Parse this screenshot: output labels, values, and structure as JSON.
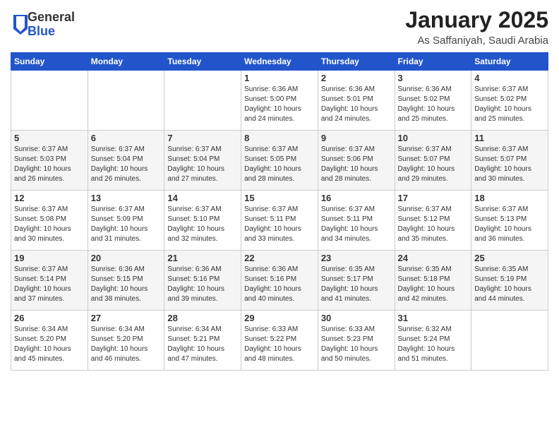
{
  "header": {
    "logo_general": "General",
    "logo_blue": "Blue",
    "month": "January 2025",
    "location": "As Saffaniyah, Saudi Arabia"
  },
  "weekdays": [
    "Sunday",
    "Monday",
    "Tuesday",
    "Wednesday",
    "Thursday",
    "Friday",
    "Saturday"
  ],
  "rows": [
    {
      "alt": false,
      "cells": [
        {
          "date": "",
          "info": ""
        },
        {
          "date": "",
          "info": ""
        },
        {
          "date": "",
          "info": ""
        },
        {
          "date": "1",
          "info": "Sunrise: 6:36 AM\nSunset: 5:00 PM\nDaylight: 10 hours\nand 24 minutes."
        },
        {
          "date": "2",
          "info": "Sunrise: 6:36 AM\nSunset: 5:01 PM\nDaylight: 10 hours\nand 24 minutes."
        },
        {
          "date": "3",
          "info": "Sunrise: 6:36 AM\nSunset: 5:02 PM\nDaylight: 10 hours\nand 25 minutes."
        },
        {
          "date": "4",
          "info": "Sunrise: 6:37 AM\nSunset: 5:02 PM\nDaylight: 10 hours\nand 25 minutes."
        }
      ]
    },
    {
      "alt": true,
      "cells": [
        {
          "date": "5",
          "info": "Sunrise: 6:37 AM\nSunset: 5:03 PM\nDaylight: 10 hours\nand 26 minutes."
        },
        {
          "date": "6",
          "info": "Sunrise: 6:37 AM\nSunset: 5:04 PM\nDaylight: 10 hours\nand 26 minutes."
        },
        {
          "date": "7",
          "info": "Sunrise: 6:37 AM\nSunset: 5:04 PM\nDaylight: 10 hours\nand 27 minutes."
        },
        {
          "date": "8",
          "info": "Sunrise: 6:37 AM\nSunset: 5:05 PM\nDaylight: 10 hours\nand 28 minutes."
        },
        {
          "date": "9",
          "info": "Sunrise: 6:37 AM\nSunset: 5:06 PM\nDaylight: 10 hours\nand 28 minutes."
        },
        {
          "date": "10",
          "info": "Sunrise: 6:37 AM\nSunset: 5:07 PM\nDaylight: 10 hours\nand 29 minutes."
        },
        {
          "date": "11",
          "info": "Sunrise: 6:37 AM\nSunset: 5:07 PM\nDaylight: 10 hours\nand 30 minutes."
        }
      ]
    },
    {
      "alt": false,
      "cells": [
        {
          "date": "12",
          "info": "Sunrise: 6:37 AM\nSunset: 5:08 PM\nDaylight: 10 hours\nand 30 minutes."
        },
        {
          "date": "13",
          "info": "Sunrise: 6:37 AM\nSunset: 5:09 PM\nDaylight: 10 hours\nand 31 minutes."
        },
        {
          "date": "14",
          "info": "Sunrise: 6:37 AM\nSunset: 5:10 PM\nDaylight: 10 hours\nand 32 minutes."
        },
        {
          "date": "15",
          "info": "Sunrise: 6:37 AM\nSunset: 5:11 PM\nDaylight: 10 hours\nand 33 minutes."
        },
        {
          "date": "16",
          "info": "Sunrise: 6:37 AM\nSunset: 5:11 PM\nDaylight: 10 hours\nand 34 minutes."
        },
        {
          "date": "17",
          "info": "Sunrise: 6:37 AM\nSunset: 5:12 PM\nDaylight: 10 hours\nand 35 minutes."
        },
        {
          "date": "18",
          "info": "Sunrise: 6:37 AM\nSunset: 5:13 PM\nDaylight: 10 hours\nand 36 minutes."
        }
      ]
    },
    {
      "alt": true,
      "cells": [
        {
          "date": "19",
          "info": "Sunrise: 6:37 AM\nSunset: 5:14 PM\nDaylight: 10 hours\nand 37 minutes."
        },
        {
          "date": "20",
          "info": "Sunrise: 6:36 AM\nSunset: 5:15 PM\nDaylight: 10 hours\nand 38 minutes."
        },
        {
          "date": "21",
          "info": "Sunrise: 6:36 AM\nSunset: 5:16 PM\nDaylight: 10 hours\nand 39 minutes."
        },
        {
          "date": "22",
          "info": "Sunrise: 6:36 AM\nSunset: 5:16 PM\nDaylight: 10 hours\nand 40 minutes."
        },
        {
          "date": "23",
          "info": "Sunrise: 6:35 AM\nSunset: 5:17 PM\nDaylight: 10 hours\nand 41 minutes."
        },
        {
          "date": "24",
          "info": "Sunrise: 6:35 AM\nSunset: 5:18 PM\nDaylight: 10 hours\nand 42 minutes."
        },
        {
          "date": "25",
          "info": "Sunrise: 6:35 AM\nSunset: 5:19 PM\nDaylight: 10 hours\nand 44 minutes."
        }
      ]
    },
    {
      "alt": false,
      "cells": [
        {
          "date": "26",
          "info": "Sunrise: 6:34 AM\nSunset: 5:20 PM\nDaylight: 10 hours\nand 45 minutes."
        },
        {
          "date": "27",
          "info": "Sunrise: 6:34 AM\nSunset: 5:20 PM\nDaylight: 10 hours\nand 46 minutes."
        },
        {
          "date": "28",
          "info": "Sunrise: 6:34 AM\nSunset: 5:21 PM\nDaylight: 10 hours\nand 47 minutes."
        },
        {
          "date": "29",
          "info": "Sunrise: 6:33 AM\nSunset: 5:22 PM\nDaylight: 10 hours\nand 48 minutes."
        },
        {
          "date": "30",
          "info": "Sunrise: 6:33 AM\nSunset: 5:23 PM\nDaylight: 10 hours\nand 50 minutes."
        },
        {
          "date": "31",
          "info": "Sunrise: 6:32 AM\nSunset: 5:24 PM\nDaylight: 10 hours\nand 51 minutes."
        },
        {
          "date": "",
          "info": ""
        }
      ]
    }
  ]
}
